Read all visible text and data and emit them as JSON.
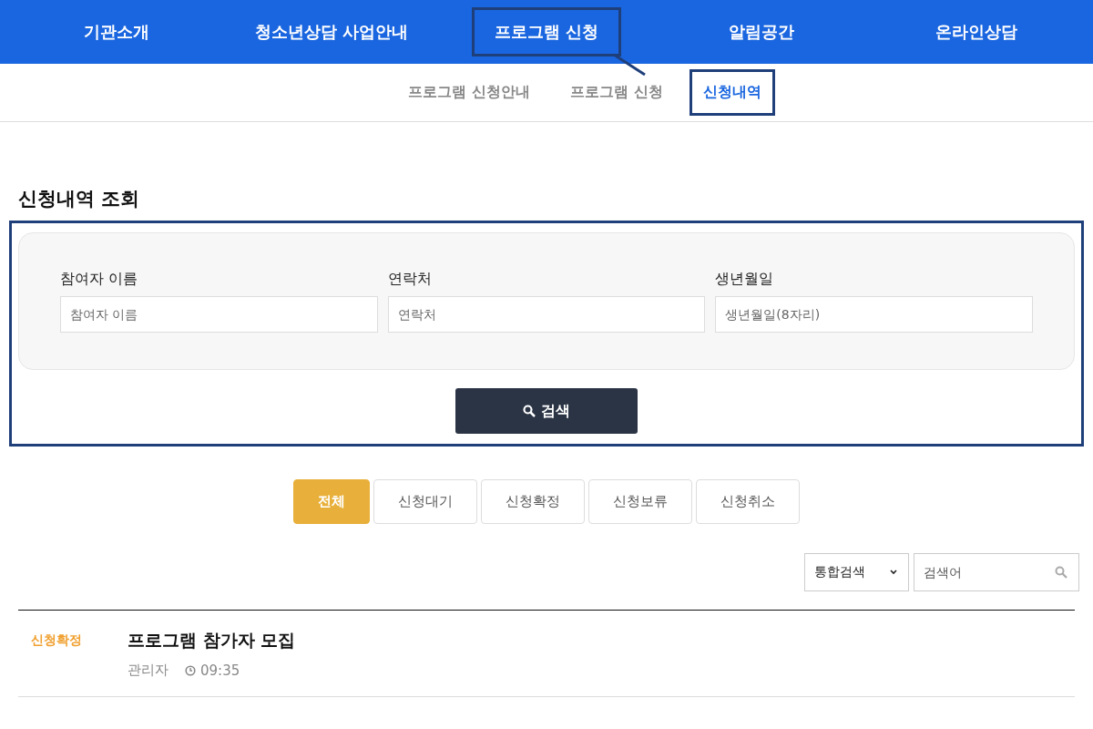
{
  "nav": [
    {
      "label": "기관소개",
      "selected": false
    },
    {
      "label": "청소년상담 사업안내",
      "selected": false
    },
    {
      "label": "프로그램 신청",
      "selected": true
    },
    {
      "label": "알림공간",
      "selected": false
    },
    {
      "label": "온라인상담",
      "selected": false
    }
  ],
  "subnav": [
    {
      "label": "프로그램 신청안내",
      "selected": false
    },
    {
      "label": "프로그램 신청",
      "selected": false
    },
    {
      "label": "신청내역",
      "selected": true
    }
  ],
  "search_form": {
    "title": "신청내역 조회",
    "fields": [
      {
        "label": "참여자 이름",
        "placeholder": "참여자 이름"
      },
      {
        "label": "연락처",
        "placeholder": "연락처"
      },
      {
        "label": "생년월일",
        "placeholder": "생년월일(8자리)"
      }
    ],
    "button": "검색"
  },
  "status_tabs": [
    {
      "label": "전체",
      "selected": true
    },
    {
      "label": "신청대기",
      "selected": false
    },
    {
      "label": "신청확정",
      "selected": false
    },
    {
      "label": "신청보류",
      "selected": false
    },
    {
      "label": "신청취소",
      "selected": false
    }
  ],
  "filter": {
    "scope": "통합검색",
    "placeholder": "검색어"
  },
  "posts": [
    {
      "status": "신청확정",
      "title": "프로그램 참가자 모집",
      "author": "관리자",
      "time": "09:35"
    }
  ]
}
